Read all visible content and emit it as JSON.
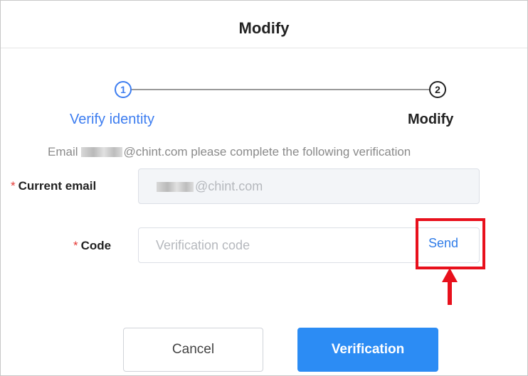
{
  "dialog": {
    "title": "Modify"
  },
  "steps": [
    {
      "number": "1",
      "label": "Verify identity",
      "state": "active",
      "color": "#3d7df0"
    },
    {
      "number": "2",
      "label": "Modify",
      "state": "pending",
      "color": "#222222"
    }
  ],
  "info": {
    "prefix": "Email",
    "suffix": "@chint.com please complete the following verification"
  },
  "form": {
    "current_email": {
      "label": "Current email",
      "required_mark": "*",
      "value_suffix": "@chint.com"
    },
    "code": {
      "label": "Code",
      "required_mark": "*",
      "placeholder": "Verification code",
      "value": "",
      "send_label": "Send"
    }
  },
  "buttons": {
    "cancel_label": "Cancel",
    "verify_label": "Verification"
  },
  "colors": {
    "accent": "#2c8cf4",
    "link": "#2f7ce8",
    "highlight": "#e8101c",
    "required": "#e53935"
  }
}
